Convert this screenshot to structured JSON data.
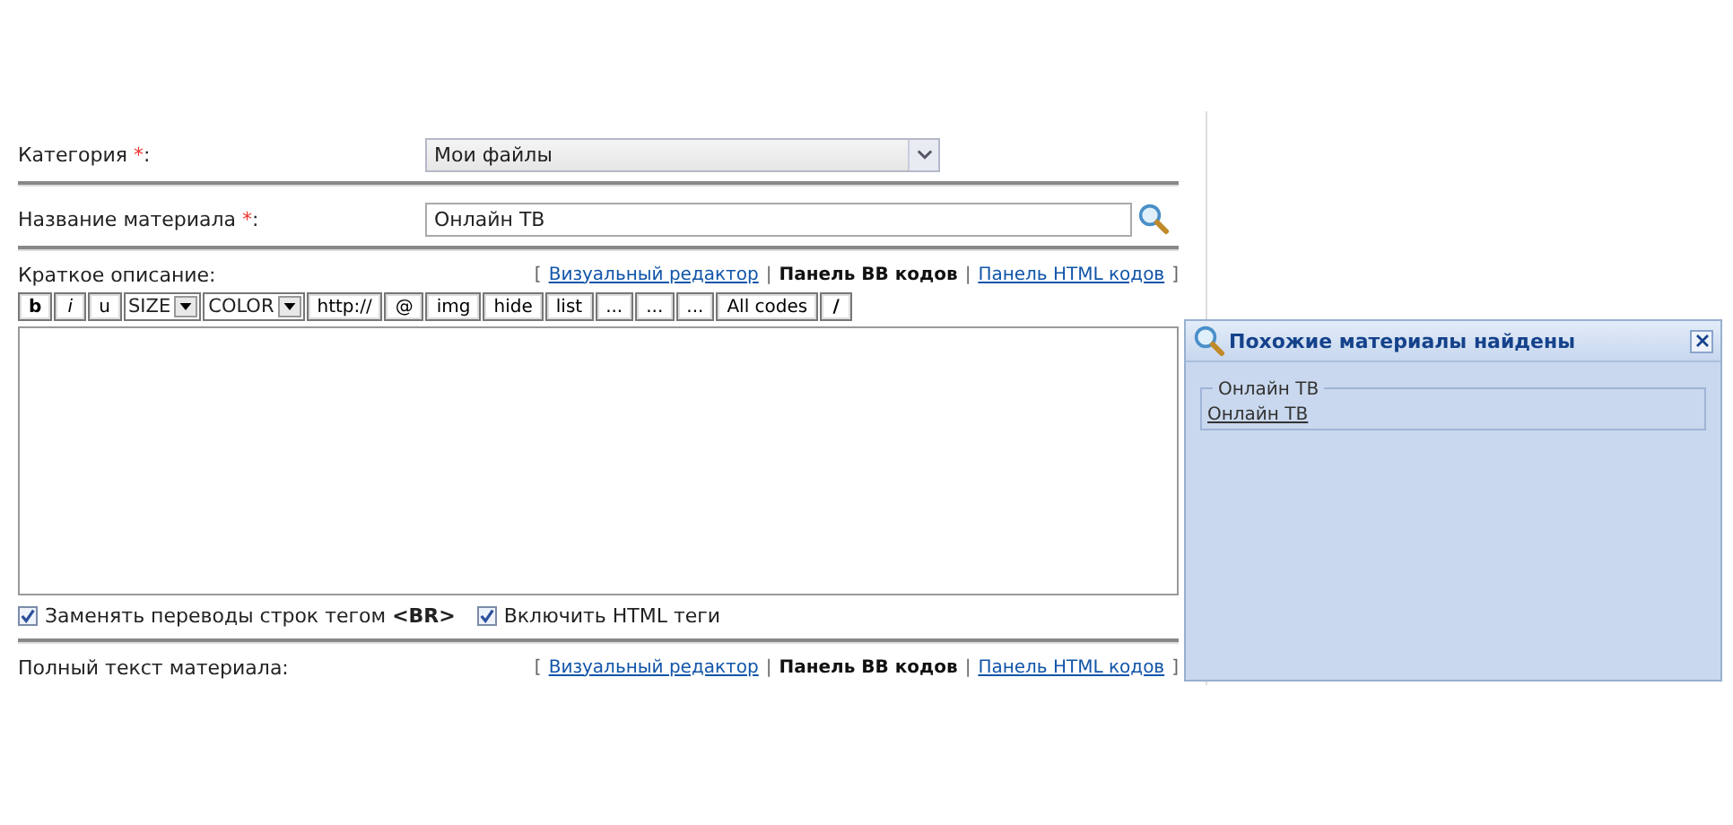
{
  "fields": [
    {
      "label": "Категория",
      "required_mark": "*",
      "separator": ":",
      "kind": "select",
      "value": "Мои файлы"
    },
    {
      "label": "Название материала",
      "required_mark": "*",
      "separator": ":",
      "kind": "text",
      "value": "Онлайн ТВ"
    }
  ],
  "short_description": {
    "label": "Краткое описание:",
    "editor_links": [
      {
        "kind": "mark",
        "text": "["
      },
      {
        "kind": "link",
        "text": "Визуальный редактор",
        "selected": false
      },
      {
        "kind": "mark",
        "text": "|"
      },
      {
        "kind": "link",
        "text": "Панель BB кодов",
        "selected": true
      },
      {
        "kind": "mark",
        "text": "|"
      },
      {
        "kind": "link",
        "text": "Панель HTML кодов",
        "selected": false
      },
      {
        "kind": "mark",
        "text": "]"
      }
    ],
    "toolbar": [
      {
        "kind": "button",
        "text": "b"
      },
      {
        "kind": "button",
        "text": "i"
      },
      {
        "kind": "button",
        "text": "u"
      },
      {
        "kind": "select",
        "text": "SIZE"
      },
      {
        "kind": "select",
        "text": "COLOR"
      },
      {
        "kind": "button",
        "text": "http://"
      },
      {
        "kind": "button",
        "text": "@"
      },
      {
        "kind": "button",
        "text": "img"
      },
      {
        "kind": "button",
        "text": "hide"
      },
      {
        "kind": "button",
        "text": "list"
      },
      {
        "kind": "button",
        "text": "..."
      },
      {
        "kind": "button",
        "text": "..."
      },
      {
        "kind": "button",
        "text": "..."
      },
      {
        "kind": "button",
        "text": "All codes"
      },
      {
        "kind": "button",
        "text": "/"
      }
    ],
    "options": [
      {
        "label": "Заменять переводы строк тегом **<BR>**",
        "checked": true
      },
      {
        "label": "Включить HTML теги",
        "checked": true
      }
    ]
  },
  "full_text": {
    "label": "Полный текст материала:",
    "editor_links": [
      {
        "kind": "mark",
        "text": "["
      },
      {
        "kind": "link",
        "text": "Визуальный редактор",
        "selected": false
      },
      {
        "kind": "mark",
        "text": "|"
      },
      {
        "kind": "link",
        "text": "Панель BB кодов",
        "selected": true
      },
      {
        "kind": "mark",
        "text": "|"
      },
      {
        "kind": "link",
        "text": "Панель HTML кодов",
        "selected": false
      },
      {
        "kind": "mark",
        "text": "]"
      }
    ]
  },
  "popup": {
    "title": "Похожие материалы найдены",
    "group_title": "Онлайн ТВ",
    "results": [
      "Онлайн ТВ"
    ]
  }
}
